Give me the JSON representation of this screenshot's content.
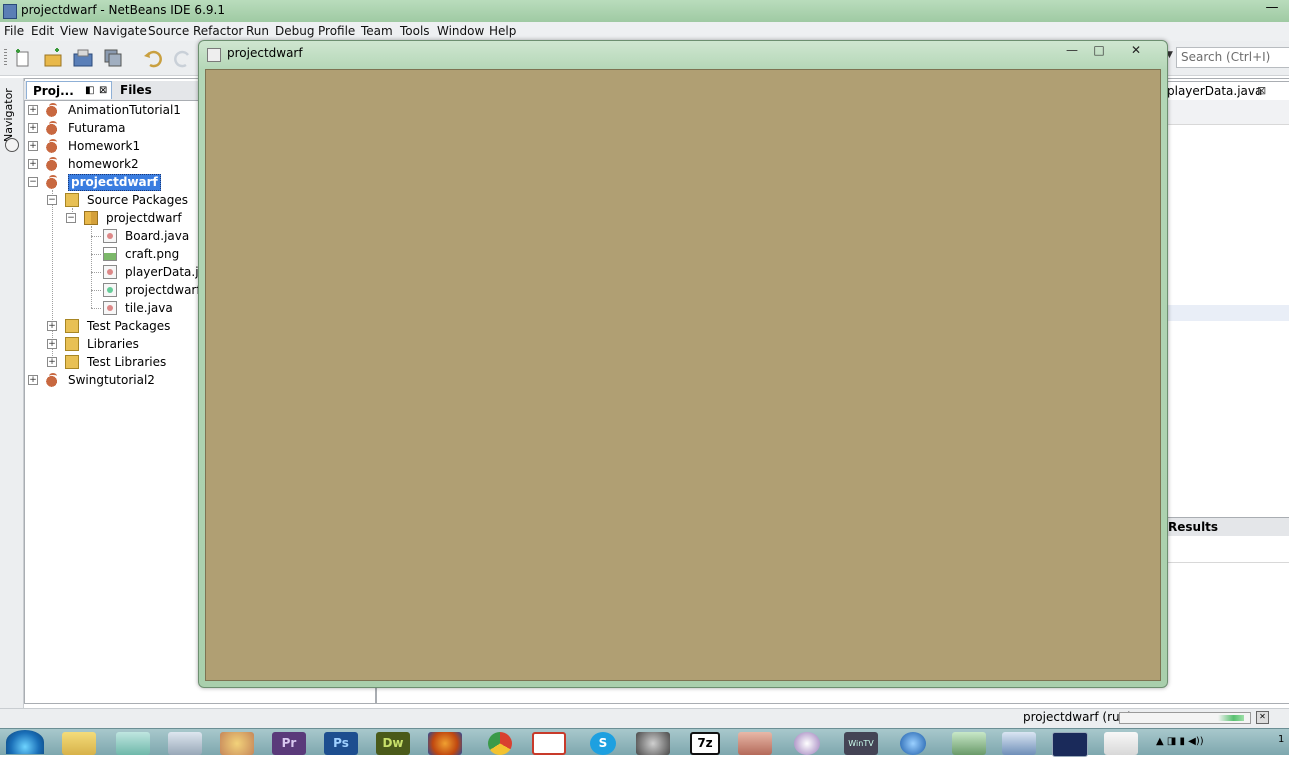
{
  "ide": {
    "title": "projectdwarf - NetBeans IDE 6.9.1",
    "minimize_glyph": "—"
  },
  "menu": [
    "File",
    "Edit",
    "View",
    "Navigate",
    "Source",
    "Refactor",
    "Run",
    "Debug",
    "Profile",
    "Team",
    "Tools",
    "Window",
    "Help"
  ],
  "toolbar": {
    "buttons": [
      "new-file-icon",
      "new-project-icon",
      "open-project-icon",
      "save-all-icon",
      "undo-icon",
      "redo-icon"
    ],
    "search_placeholder": "Search (Ctrl+I)"
  },
  "navigator": {
    "label": "Navigator"
  },
  "panel": {
    "tabs": {
      "projects": "Proj...",
      "files": "Files"
    },
    "tree": [
      {
        "label": "AnimationTutorial1",
        "icon": "project-icon",
        "level": 0,
        "expander": "+"
      },
      {
        "label": "Futurama",
        "icon": "project-icon",
        "level": 0,
        "expander": "+"
      },
      {
        "label": "Homework1",
        "icon": "project-icon",
        "level": 0,
        "expander": "+"
      },
      {
        "label": "homework2",
        "icon": "project-icon",
        "level": 0,
        "expander": "+"
      },
      {
        "label": "projectdwarf",
        "icon": "project-icon",
        "level": 0,
        "expander": "−",
        "selected": true
      },
      {
        "label": "Source Packages",
        "icon": "folder-icon",
        "level": 1,
        "expander": "−"
      },
      {
        "label": "projectdwarf",
        "icon": "package-icon",
        "level": 2,
        "expander": "−"
      },
      {
        "label": "Board.java",
        "icon": "java-file-icon",
        "level": 3
      },
      {
        "label": "craft.png",
        "icon": "image-file-icon",
        "level": 3
      },
      {
        "label": "playerData.java",
        "icon": "java-file-icon",
        "level": 3
      },
      {
        "label": "projectdwarf.java",
        "icon": "main-java-file-icon",
        "level": 3
      },
      {
        "label": "tile.java",
        "icon": "java-file-icon",
        "level": 3
      },
      {
        "label": "Test Packages",
        "icon": "folder-icon",
        "level": 1,
        "expander": "+"
      },
      {
        "label": "Libraries",
        "icon": "library-icon",
        "level": 1,
        "expander": "+"
      },
      {
        "label": "Test Libraries",
        "icon": "library-icon",
        "level": 1,
        "expander": "+"
      },
      {
        "label": "Swingtutorial2",
        "icon": "project-icon",
        "level": 0,
        "expander": "+"
      }
    ]
  },
  "editor": {
    "tab_label": "playerData.java",
    "results_label": "Results"
  },
  "status": {
    "text": "projectdwarf (run)",
    "progress": 0.2
  },
  "java_window": {
    "title": "projectdwarf",
    "min_glyph": "—",
    "max_glyph": "□",
    "close_glyph": "✕",
    "canvas_color": "#b09f73"
  },
  "taskbar": {
    "apps": [
      "start-orb",
      "explorer-icon",
      "notepad-icon",
      "calculator-icon",
      "paint-icon",
      "premiere-icon",
      "photoshop-icon",
      "dreamweaver-icon",
      "firefox-icon",
      "chrome-icon",
      "gmail-icon",
      "skype-icon",
      "steam-icon",
      "7zip-icon",
      "tool-icon",
      "media-icon",
      "wintv-icon",
      "thunder-icon",
      "recycle-icon",
      "netbeans-icon",
      "game-icon",
      "java-icon"
    ],
    "clock": "1"
  }
}
